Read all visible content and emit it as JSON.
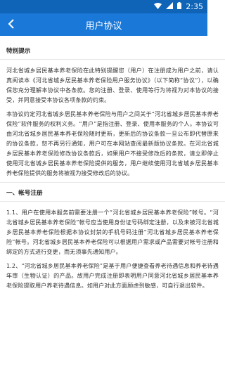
{
  "status": {
    "time": "2:35"
  },
  "appbar": {
    "title": "用户协议"
  },
  "content": {
    "notice_heading": "特别提示",
    "p1": "河北省城乡居民基本养老保险在此特别提醒您（用户）在注册成为用户之前，请认真阅读本《河北省城乡居民基本养老保险用户服务协议》（以下简称“协议”），以确保您充分理解本协议中各条款。您的注册、登录、使用等行为将视为对本协议的接受，并同意接受本协议各项条款的约束。",
    "p2": "本协议约定河北省城乡居民基本养老保险与用户之间关于“河北省城乡居民基本养老保险”软件服务的权利义务。“用户”是指注册、登录、使用本服务的个人。本协议可由河北省城乡居民基本养老保险随时更新，更新后的协议条款一旦公布即代替原来的协议条款，恕不再另行通知，用户可在本网站查阅最新版协议条款。在河北省城乡居民基本养老保险修改协议条款后，如果用户不接受修改后的条款，请立即停止使用河北省城乡居民基本养老保险提供的服务，用户继续使用河北省城乡居民基本养老保险提供的服务将被视为接受修改后的协议。",
    "section1_heading": "一、帐号注册",
    "p3": "1.1、用户在使用本服务前需要注册一个“河北省城乡居民基本养老保险”帐号。“河北省城乡居民基本养老保险”帐号应当使用身份证号码绑定注册，以及未被河北省城乡居民基本养老保险根据本协议封禁的手机号码注册“河北省城乡居民基本养老保险”帐号。河北省城乡居民基本养老保险可以根据用户需求或产品需要对帐号注册和绑定的方式进行变更，而无须事先通知用户。",
    "p4": "1.2、“河北省城乡居民基本养老保险”是基于用户便捷查看养老待遇信息和养老待遇年审（生物认证）的产品。故用户完成注册即表明用户同意河北省城乡居民基本养老保险提取用户养老待遇信息。如用户对此方面顾虑到敏感，可自行退出软件。"
  }
}
